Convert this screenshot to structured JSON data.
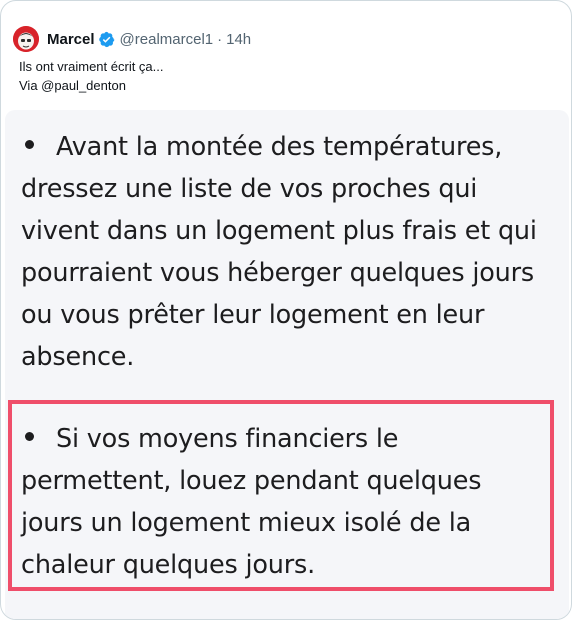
{
  "tweet": {
    "display_name": "Marcel",
    "handle": "@realmarcel1",
    "separator": "·",
    "time": "14h",
    "verified": true,
    "text_lines": [
      "Ils ont vraiment écrit ça...",
      "Via @paul_denton"
    ]
  },
  "image": {
    "block1_lines": [
      "Avant la montée des températures,",
      "dressez une liste de vos proches qui",
      "vivent dans un logement plus frais et qui",
      "pourraient vous héberger quelques jours",
      "ou vous prêter leur logement en leur",
      "absence."
    ],
    "block2_lines": [
      "Si vos moyens financiers le",
      "permettent, louez pendant quelques",
      "jours un logement mieux isolé de la",
      "chaleur quelques jours."
    ],
    "highlight_color": "#ef4e6a"
  },
  "colors": {
    "verified_badge": "#1d9bf0",
    "secondary_text": "#536471",
    "avatar_bg": "#d8232a"
  }
}
